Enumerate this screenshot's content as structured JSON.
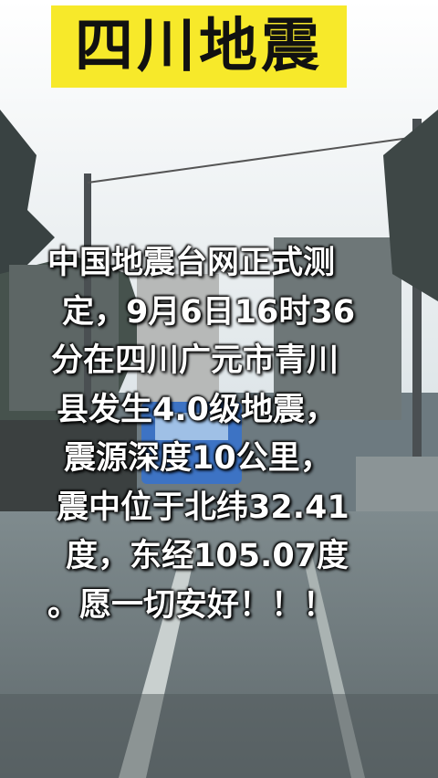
{
  "banner": {
    "title": "四川地震",
    "background": "#f7e92a"
  },
  "caption": {
    "lines": [
      "中国地震台网正式测",
      "定，9月6日16时36",
      "分在四川广元市青川",
      "县发生4.0级地震，",
      "震源深度10公里，",
      "震中位于北纬32.41",
      "度，东经105.07度",
      "。愿一切安好！！！"
    ],
    "color": "#ffffff"
  }
}
